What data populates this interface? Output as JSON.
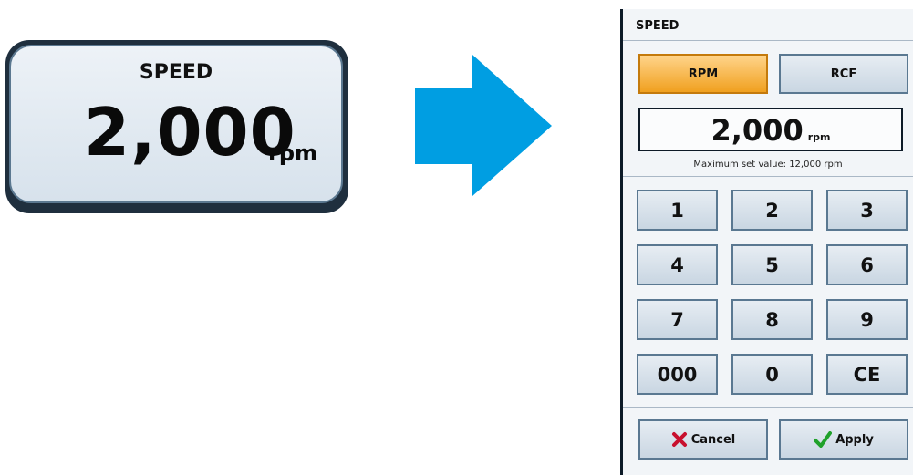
{
  "tile": {
    "title": "SPEED",
    "value": "2,000",
    "unit": "rpm"
  },
  "arrow": {
    "icon": "right-arrow-icon",
    "color": "#009ee2"
  },
  "dialog": {
    "title": "SPEED",
    "modes": [
      {
        "label": "RPM",
        "active": true
      },
      {
        "label": "RCF",
        "active": false
      }
    ],
    "display": {
      "value": "2,000",
      "unit": "rpm"
    },
    "max_note": "Maximum set value: 12,000 rpm",
    "keys": [
      "1",
      "2",
      "3",
      "4",
      "5",
      "6",
      "7",
      "8",
      "9",
      "000",
      "0",
      "CE"
    ],
    "cancel": {
      "label": "Cancel",
      "icon": "x-icon",
      "color": "#c8102e"
    },
    "apply": {
      "label": "Apply",
      "icon": "check-icon",
      "color": "#1fa12a"
    },
    "accent_active": "#f0a01f"
  }
}
